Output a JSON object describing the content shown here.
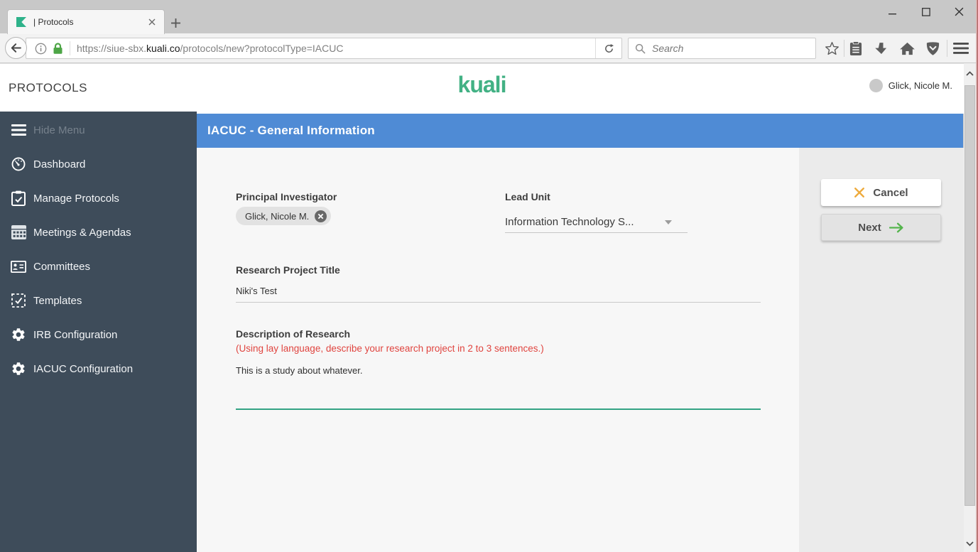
{
  "window": {
    "tab_title": "| Protocols"
  },
  "browser": {
    "url_prefix": "https://siue-sbx.",
    "url_domain": "kuali.co",
    "url_path": "/protocols/new?protocolType=IACUC",
    "search_placeholder": "Search"
  },
  "header": {
    "app_title": "PROTOCOLS",
    "logo_text": "kuali",
    "user_name": "Glick, Nicole M."
  },
  "sidebar": {
    "items": [
      {
        "label": "Hide Menu",
        "icon": "hamburger-icon"
      },
      {
        "label": "Dashboard",
        "icon": "gauge-icon"
      },
      {
        "label": "Manage Protocols",
        "icon": "clipboard-check-icon"
      },
      {
        "label": "Meetings & Agendas",
        "icon": "calendar-icon"
      },
      {
        "label": "Committees",
        "icon": "id-card-icon"
      },
      {
        "label": "Templates",
        "icon": "dashed-checkbox-icon"
      },
      {
        "label": "IRB Configuration",
        "icon": "gear-icon"
      },
      {
        "label": "IACUC Configuration",
        "icon": "gear-icon"
      }
    ]
  },
  "form": {
    "section_title": "IACUC - General Information",
    "principal_investigator": {
      "label": "Principal Investigator",
      "chip": "Glick, Nicole M."
    },
    "lead_unit": {
      "label": "Lead Unit",
      "value": "Information Technology S..."
    },
    "project_title": {
      "label": "Research Project Title",
      "value": "Niki's Test"
    },
    "description": {
      "label": "Description of Research",
      "hint": "(Using lay language, describe your research project in 2 to 3 sentences.)",
      "value": "This is a study about whatever."
    }
  },
  "actions": {
    "cancel_label": "Cancel",
    "next_label": "Next"
  },
  "colors": {
    "kuali_green": "#42b184",
    "blue_bar": "#4f8bd5",
    "sidebar_bg": "#3e4c5a",
    "hint_red": "#e0443f",
    "cancel_x_amber": "#eeab3e",
    "next_arrow_green": "#54b44c",
    "lock_green": "#4da546",
    "focus_underline_green": "#33a384"
  }
}
